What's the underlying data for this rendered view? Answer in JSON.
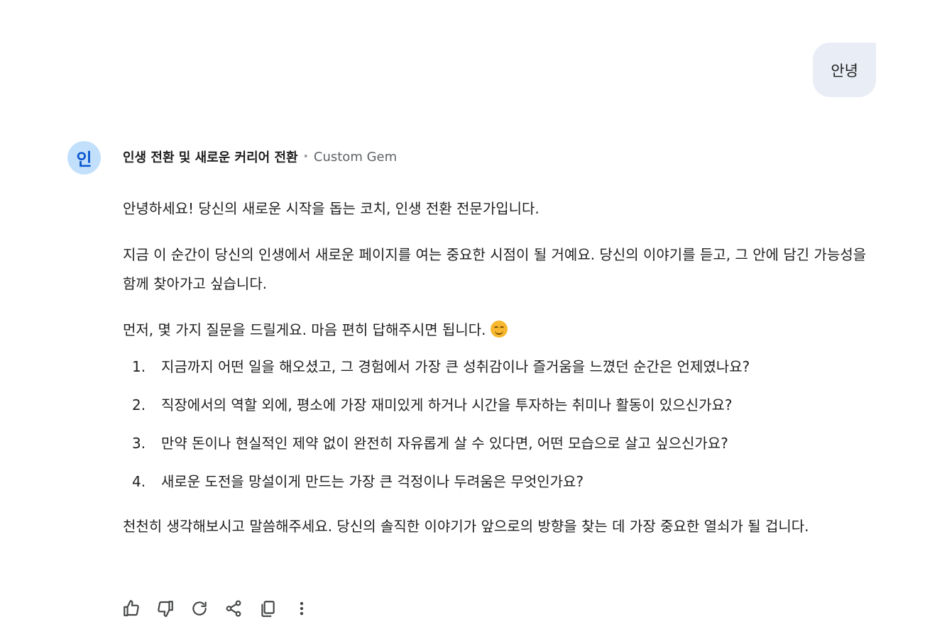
{
  "user_message": {
    "text": "안녕"
  },
  "assistant": {
    "avatar_letter": "인",
    "gem_name": "인생 전환 및 새로운 커리어 전환",
    "gem_separator": "•",
    "gem_type": "Custom Gem",
    "paragraphs": [
      "안녕하세요! 당신의 새로운 시작을 돕는 코치, 인생 전환 전문가입니다.",
      "지금 이 순간이 당신의 인생에서 새로운 페이지를 여는 중요한 시점이 될 거예요. 당신의 이야기를 듣고, 그 안에 담긴 가능성을 함께 찾아가고 싶습니다.",
      "먼저, 몇 가지 질문을 드릴게요. 마음 편히 답해주시면 됩니다."
    ],
    "emoji_name": "smiling-face-emoji",
    "questions": [
      {
        "number": "1.",
        "text": "지금까지 어떤 일을 해오셨고, 그 경험에서 가장 큰 성취감이나 즐거움을 느꼈던 순간은 언제였나요?"
      },
      {
        "number": "2.",
        "text": "직장에서의 역할 외에, 평소에 가장 재미있게 하거나 시간을 투자하는 취미나 활동이 있으신가요?"
      },
      {
        "number": "3.",
        "text": "만약 돈이나 현실적인 제약 없이 완전히 자유롭게 살 수 있다면, 어떤 모습으로 살고 싶으신가요?"
      },
      {
        "number": "4.",
        "text": "새로운 도전을 망설이게 만드는 가장 큰 걱정이나 두려움은 무엇인가요?"
      }
    ],
    "closing": "천천히 생각해보시고 말씀해주세요. 당신의 솔직한 이야기가 앞으로의 방향을 찾는 데 가장 중요한 열쇠가 될 겁니다."
  },
  "actions": [
    {
      "icon": "thumbs-up-icon"
    },
    {
      "icon": "thumbs-down-icon"
    },
    {
      "icon": "regenerate-icon"
    },
    {
      "icon": "share-icon"
    },
    {
      "icon": "copy-icon"
    },
    {
      "icon": "more-vert-icon"
    }
  ],
  "colors": {
    "user_bubble_bg": "#e9eef6",
    "avatar_bg": "#c2e0fc",
    "avatar_text": "#0b57d0",
    "text": "#1f1f1f",
    "muted": "#5f6368",
    "icon": "#444746"
  }
}
